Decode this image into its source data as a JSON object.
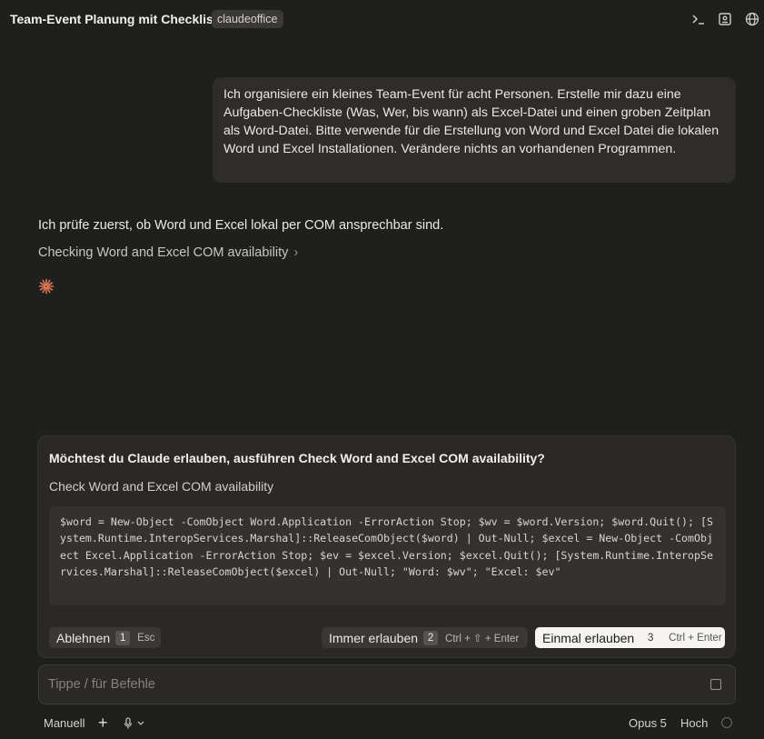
{
  "header": {
    "title": "Team-Event Planung mit Checkliste",
    "project": "claudeoffice",
    "icons": [
      "terminal-icon",
      "panel-icon",
      "globe-icon"
    ]
  },
  "conversation": {
    "user_message": "Ich organisiere ein kleines Team-Event für acht Personen. Erstelle mir dazu eine Aufgaben-Checkliste (Was, Wer, bis wann) als Excel-Datei und einen groben Zeitplan als Word-Datei. Bitte verwende für die Erstellung von Word und Excel Datei die lokalen Word und Excel Installationen. Verändere nichts an vorhandenen Programmen.",
    "assistant_text": "Ich prüfe zuerst, ob Word und Excel lokal per COM ansprechbar sind.",
    "tool_call": "Checking Word and Excel COM availability",
    "accent_color": "#d97757"
  },
  "permission_dialog": {
    "question": "Möchtest du Claude erlauben, ausführen Check Word and Excel COM availability?",
    "description": "Check Word and Excel COM availability",
    "command": "$word = New-Object -ComObject Word.Application -ErrorAction Stop; $wv = $word.Version; $word.Quit(); [System.Runtime.InteropServices.Marshal]::ReleaseComObject($word) | Out-Null; $excel = New-Object -ComObject Excel.Application -ErrorAction Stop; $ev = $excel.Version; $excel.Quit(); [System.Runtime.InteropServices.Marshal]::ReleaseComObject($excel) | Out-Null; \"Word: $wv\"; \"Excel: $ev\"",
    "deny": {
      "label": "Ablehnen",
      "key": "1",
      "hint": "Esc"
    },
    "always": {
      "label": "Immer erlauben",
      "key": "2",
      "hint": "Ctrl + ⇧ + Enter"
    },
    "once": {
      "label": "Einmal erlauben",
      "key": "3",
      "hint": "Ctrl + Enter"
    }
  },
  "composer": {
    "placeholder": "Tippe / für Befehle",
    "mode": "Manuell",
    "add": "+",
    "model": "Opus 5",
    "effort": "Hoch"
  }
}
